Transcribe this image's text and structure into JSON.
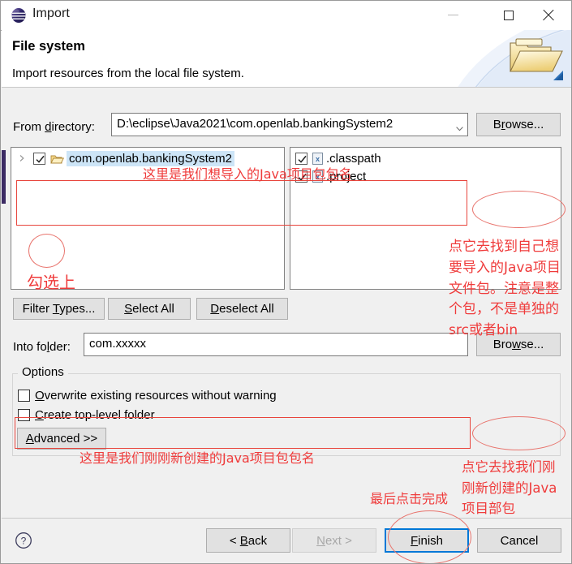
{
  "window": {
    "title": "Import",
    "app_icon": "eclipse-icon",
    "controls": {
      "minimize": "minimize-icon",
      "maximize": "maximize-icon",
      "close": "close-icon"
    }
  },
  "banner": {
    "title": "File system",
    "description": "Import resources from the local file system.",
    "icon": "folder-icon"
  },
  "form": {
    "from_directory_label": "From directory:",
    "from_directory_value": "D:\\eclipse\\Java2021\\com.openlab.bankingSystem2",
    "browse_label_1": "Browse...",
    "into_folder_label": "Into folder:",
    "into_folder_value": "com.xxxxx",
    "browse_label_2": "Browse..."
  },
  "tree": {
    "items": [
      {
        "label": "com.openlab.bankingSystem2",
        "checked": true,
        "selected": true,
        "icon": "open-folder-icon",
        "expander": "chevron-right-icon"
      }
    ]
  },
  "files": {
    "items": [
      {
        "label": ".classpath",
        "checked": true,
        "icon": "xml-file-icon"
      },
      {
        "label": ".project",
        "checked": true,
        "icon": "xml-file-icon"
      }
    ]
  },
  "buttons": {
    "filter_types": "Filter Types...",
    "select_all": "Select All",
    "deselect_all": "Deselect All",
    "advanced": "Advanced >>"
  },
  "options": {
    "legend": "Options",
    "items": [
      {
        "label": "Overwrite existing resources without warning",
        "checked": false
      },
      {
        "label": "Create top-level folder",
        "checked": false
      }
    ]
  },
  "footer": {
    "help_icon": "help-icon",
    "back": "< Back",
    "next": "Next >",
    "finish": "Finish",
    "cancel": "Cancel",
    "next_enabled": false,
    "finish_focused": true
  },
  "annotations": [
    {
      "id": "anno-1",
      "text": "这里是我们想导入的Java项目包包名"
    },
    {
      "id": "anno-2",
      "text": "勾选上"
    },
    {
      "id": "anno-3",
      "text": "点它去找到自己想要导入的Java项目文件包。注意是整个包，不是单独的src或者bin"
    },
    {
      "id": "anno-4",
      "text": "这里是我们刚刚新创建的Java项目包包名"
    },
    {
      "id": "anno-5",
      "text": "点它去找我们刚刚新创建的Java项目部包"
    },
    {
      "id": "anno-6",
      "text": "最后点击完成"
    }
  ],
  "colors": {
    "annotation_red": "#ef3b3b",
    "box_red": "#e8453c",
    "ellipse_red": "#e8736c",
    "focus_blue": "#0078d7",
    "selection_blue": "#cde5f7",
    "dialog_bg": "#f0f0f0"
  }
}
